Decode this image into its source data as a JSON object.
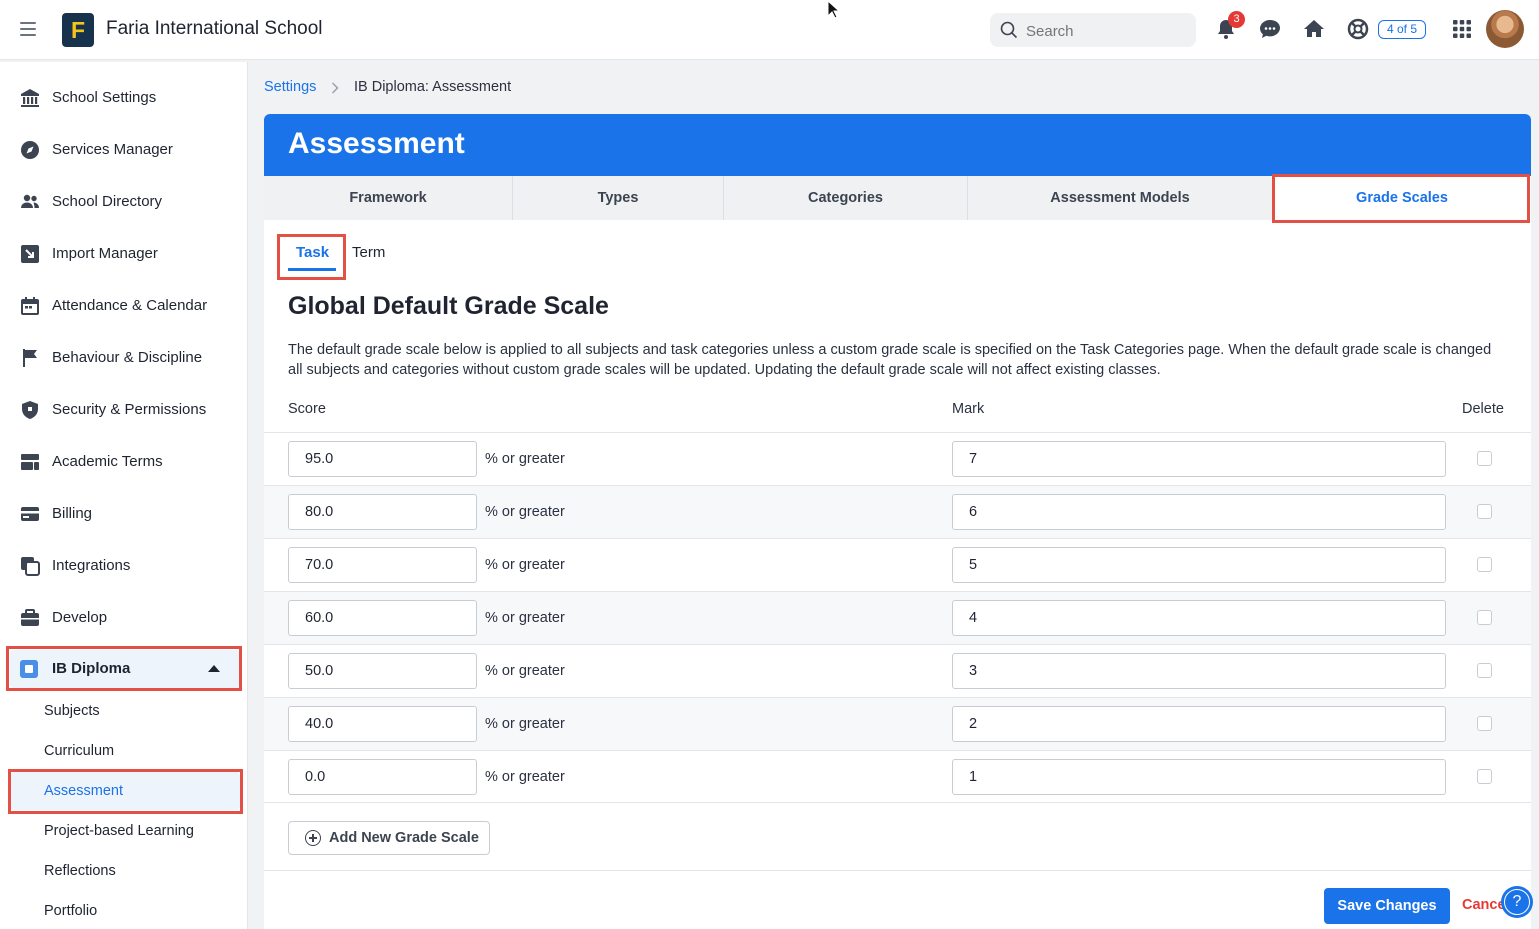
{
  "header": {
    "school_name": "Faria International School",
    "search_placeholder": "Search",
    "notification_count": "3",
    "page_counter": "4 of 5"
  },
  "sidebar": {
    "items": [
      {
        "label": "School Settings",
        "icon": "bank-icon"
      },
      {
        "label": "Services Manager",
        "icon": "compass-icon"
      },
      {
        "label": "School Directory",
        "icon": "people-icon"
      },
      {
        "label": "Import Manager",
        "icon": "import-icon"
      },
      {
        "label": "Attendance & Calendar",
        "icon": "calendar-icon"
      },
      {
        "label": "Behaviour & Discipline",
        "icon": "flag-icon"
      },
      {
        "label": "Security & Permissions",
        "icon": "shield-icon"
      },
      {
        "label": "Academic Terms",
        "icon": "terms-icon"
      },
      {
        "label": "Billing",
        "icon": "card-icon"
      },
      {
        "label": "Integrations",
        "icon": "integrations-icon"
      },
      {
        "label": "Develop",
        "icon": "briefcase-icon"
      }
    ],
    "ib": {
      "label": "IB Diploma",
      "subitems": [
        "Subjects",
        "Curriculum",
        "Assessment",
        "Project-based Learning",
        "Reflections",
        "Portfolio"
      ],
      "active": "Assessment"
    }
  },
  "breadcrumb": {
    "parent": "Settings",
    "current": "IB Diploma: Assessment"
  },
  "panel": {
    "title": "Assessment",
    "tabs": [
      "Framework",
      "Types",
      "Categories",
      "Assessment Models",
      "Grade Scales"
    ],
    "active_tab": "Grade Scales",
    "subtabs": [
      "Task",
      "Term"
    ],
    "active_subtab": "Task",
    "section_title": "Global Default Grade Scale",
    "description": "The default grade scale below is applied to all subjects and task categories unless a custom grade scale is specified on the Task Categories page. When the default grade scale is changed all subjects and categories without custom grade scales will be updated. Updating the default grade scale will not affect existing classes.",
    "columns": {
      "score": "Score",
      "mark": "Mark",
      "delete": "Delete"
    },
    "score_suffix": "% or greater",
    "rows": [
      {
        "score": "95.0",
        "mark": "7"
      },
      {
        "score": "80.0",
        "mark": "6"
      },
      {
        "score": "70.0",
        "mark": "5"
      },
      {
        "score": "60.0",
        "mark": "4"
      },
      {
        "score": "50.0",
        "mark": "3"
      },
      {
        "score": "40.0",
        "mark": "2"
      },
      {
        "score": "0.0",
        "mark": "1"
      }
    ],
    "add_button": "Add New Grade Scale",
    "save_button": "Save Changes",
    "cancel_button": "Cance"
  },
  "colors": {
    "accent": "#1a73e8",
    "highlight": "#e35146",
    "danger": "#e53935"
  }
}
